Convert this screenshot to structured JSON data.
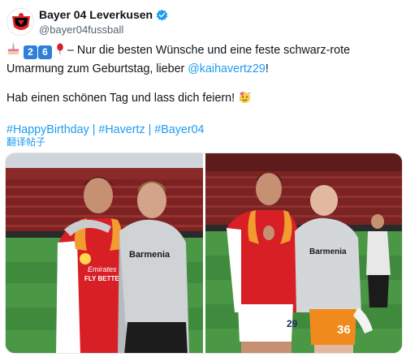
{
  "account": {
    "display_name": "Bayer 04 Leverkusen",
    "handle": "@bayer04fussball",
    "avatar_icon": "bayer-04-crest-icon",
    "verified_icon": "verified-badge-icon",
    "verified_color": "#1d9bf0"
  },
  "tweet": {
    "badge_digits": [
      "2",
      "6"
    ],
    "line1_rest": " – Nur die besten Wünsche und eine feste schwarz-rote",
    "line2_prefix": "Umarmung zum Geburtstag, lieber ",
    "mention": "@kaihavertz29",
    "line2_suffix": "!",
    "line3": "Hab einen schönen Tag und lass dich feiern! ",
    "hashtags": [
      "#HappyBirthday",
      "#Havertz",
      "#Bayer04"
    ],
    "hashtag_separator": " | ",
    "translate_label": "翻译帖子",
    "link_color": "#1d9bf0"
  },
  "media": {
    "photos": [
      {
        "description_icon": "photo-1"
      },
      {
        "description_icon": "photo-2"
      }
    ],
    "sponsor_text": "Barmenia",
    "shirt_text": "FLY BETTER",
    "shirt_brand": "Emirates",
    "number_left": "29",
    "number_right": "36"
  }
}
